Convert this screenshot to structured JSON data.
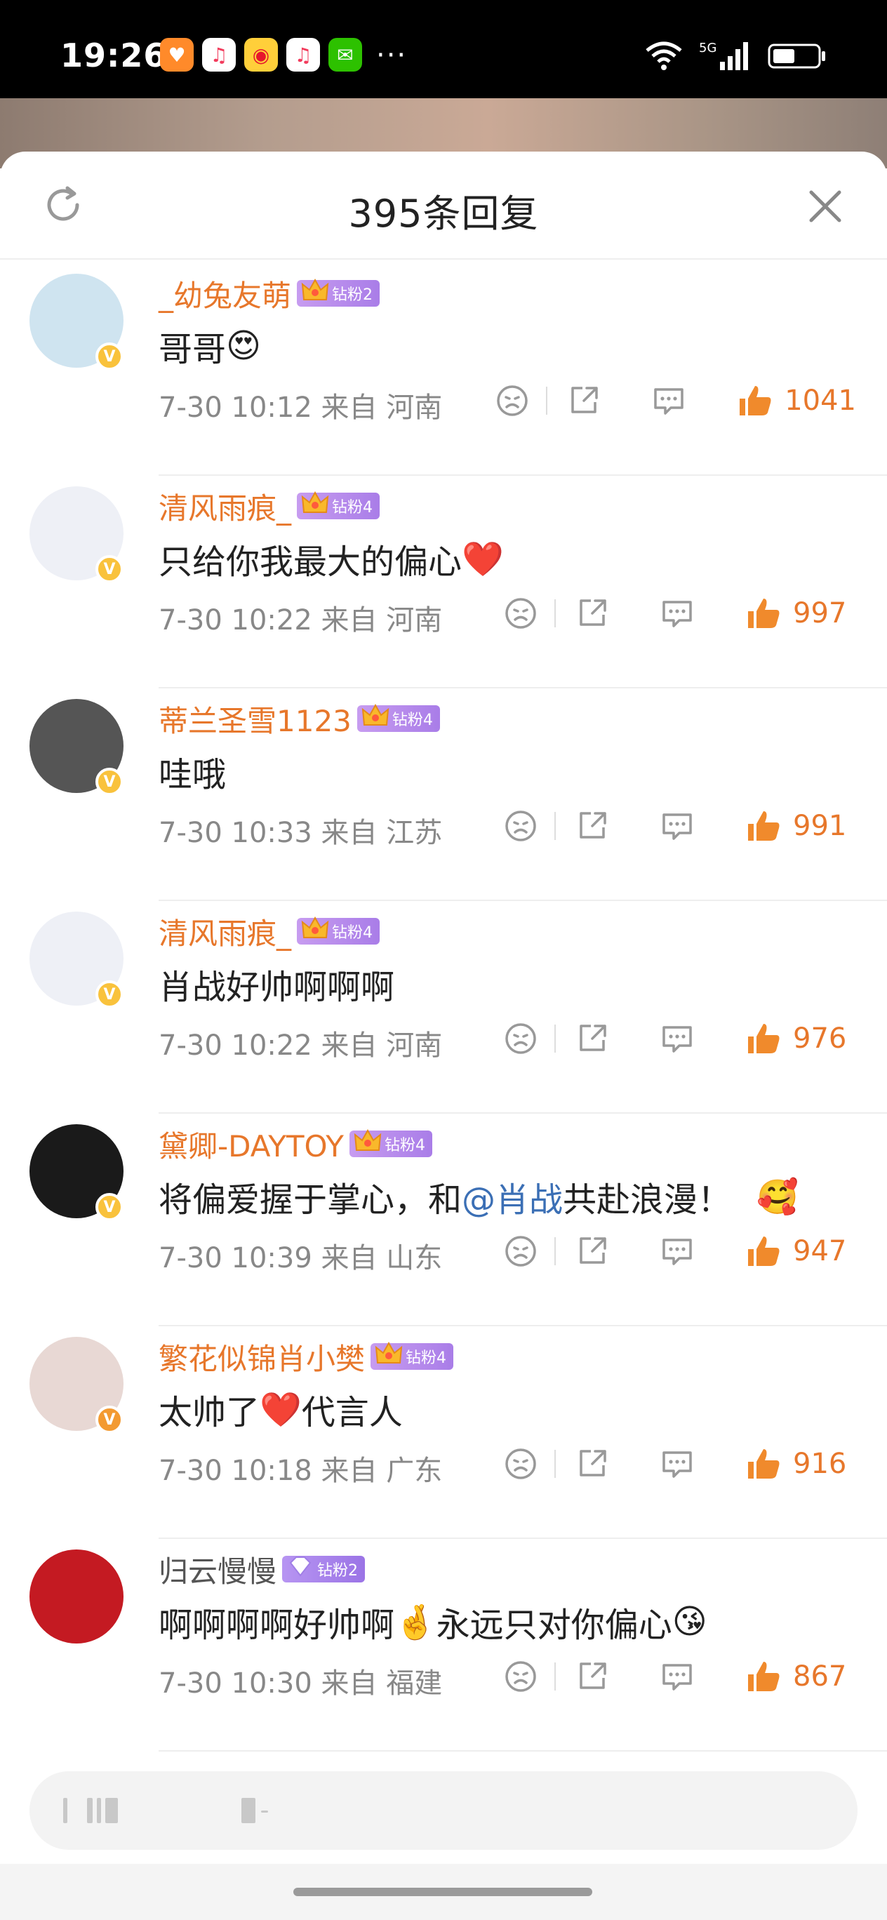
{
  "status_bar": {
    "time": "19:26",
    "more": "···",
    "network": "5G",
    "wifi_num": "6",
    "apps": [
      "orange-heart-app",
      "music-app",
      "weibo-app",
      "music-app-2",
      "wechat-app"
    ]
  },
  "sheet": {
    "title": "395条回复"
  },
  "comments": [
    {
      "user": "_幼兔友萌",
      "badge": "钻粉2",
      "text": "哥哥",
      "emoji": "😍",
      "meta": "7-30 10:12  来自 河南",
      "likes": "1041",
      "verify": "yellow",
      "avatar_bg": "#cfe4f0"
    },
    {
      "user": "清风雨痕_",
      "badge": "钻粉4",
      "text": "只给你我最大的偏心",
      "emoji": "❤️",
      "meta": "7-30 10:22  来自 河南",
      "likes": "997",
      "verify": "yellow",
      "avatar_bg": "#eef0f6"
    },
    {
      "user": "蒂兰圣雪1123",
      "badge": "钻粉4",
      "text": "哇哦",
      "emoji": "",
      "meta": "7-30 10:33  来自 江苏",
      "likes": "991",
      "verify": "yellow",
      "avatar_bg": "#555555"
    },
    {
      "user": "清风雨痕_",
      "badge": "钻粉4",
      "text": "肖战好帅啊啊啊",
      "emoji": "",
      "meta": "7-30 10:22  来自 河南",
      "likes": "976",
      "verify": "yellow",
      "avatar_bg": "#eef0f6"
    },
    {
      "user": "黛卿-DAYTOY",
      "badge": "钻粉4",
      "text_pre": "将偏爱握于掌心，和",
      "mention": "@肖战",
      "text_post": " 共赴浪漫！",
      "emoji": "🥰",
      "meta": "7-30 10:39  来自 山东",
      "likes": "947",
      "verify": "yellow",
      "avatar_bg": "#1a1a1a"
    },
    {
      "user": "繁花似锦肖小樊",
      "badge": "钻粉4",
      "text_pre": "太帅了",
      "text_heart": "❤️",
      "text_post": "代言人",
      "meta": "7-30 10:18  来自 广东",
      "likes": "916",
      "verify": "orange",
      "avatar_bg": "#e8d8d4"
    },
    {
      "user": "归云慢慢",
      "badge": "钻粉2",
      "text_pre": "啊啊啊啊好帅啊",
      "text_hand": "🤞",
      "text_post": "永远只对你偏心",
      "emoji": "😘",
      "meta": "7-30 10:30  来自 福建",
      "likes": "867",
      "verify": "none",
      "avatar_bg": "#c41a22"
    }
  ],
  "colors": {
    "accent": "#e7772b",
    "badge_purple": "#a97de8",
    "mention": "#3b6fb5"
  }
}
